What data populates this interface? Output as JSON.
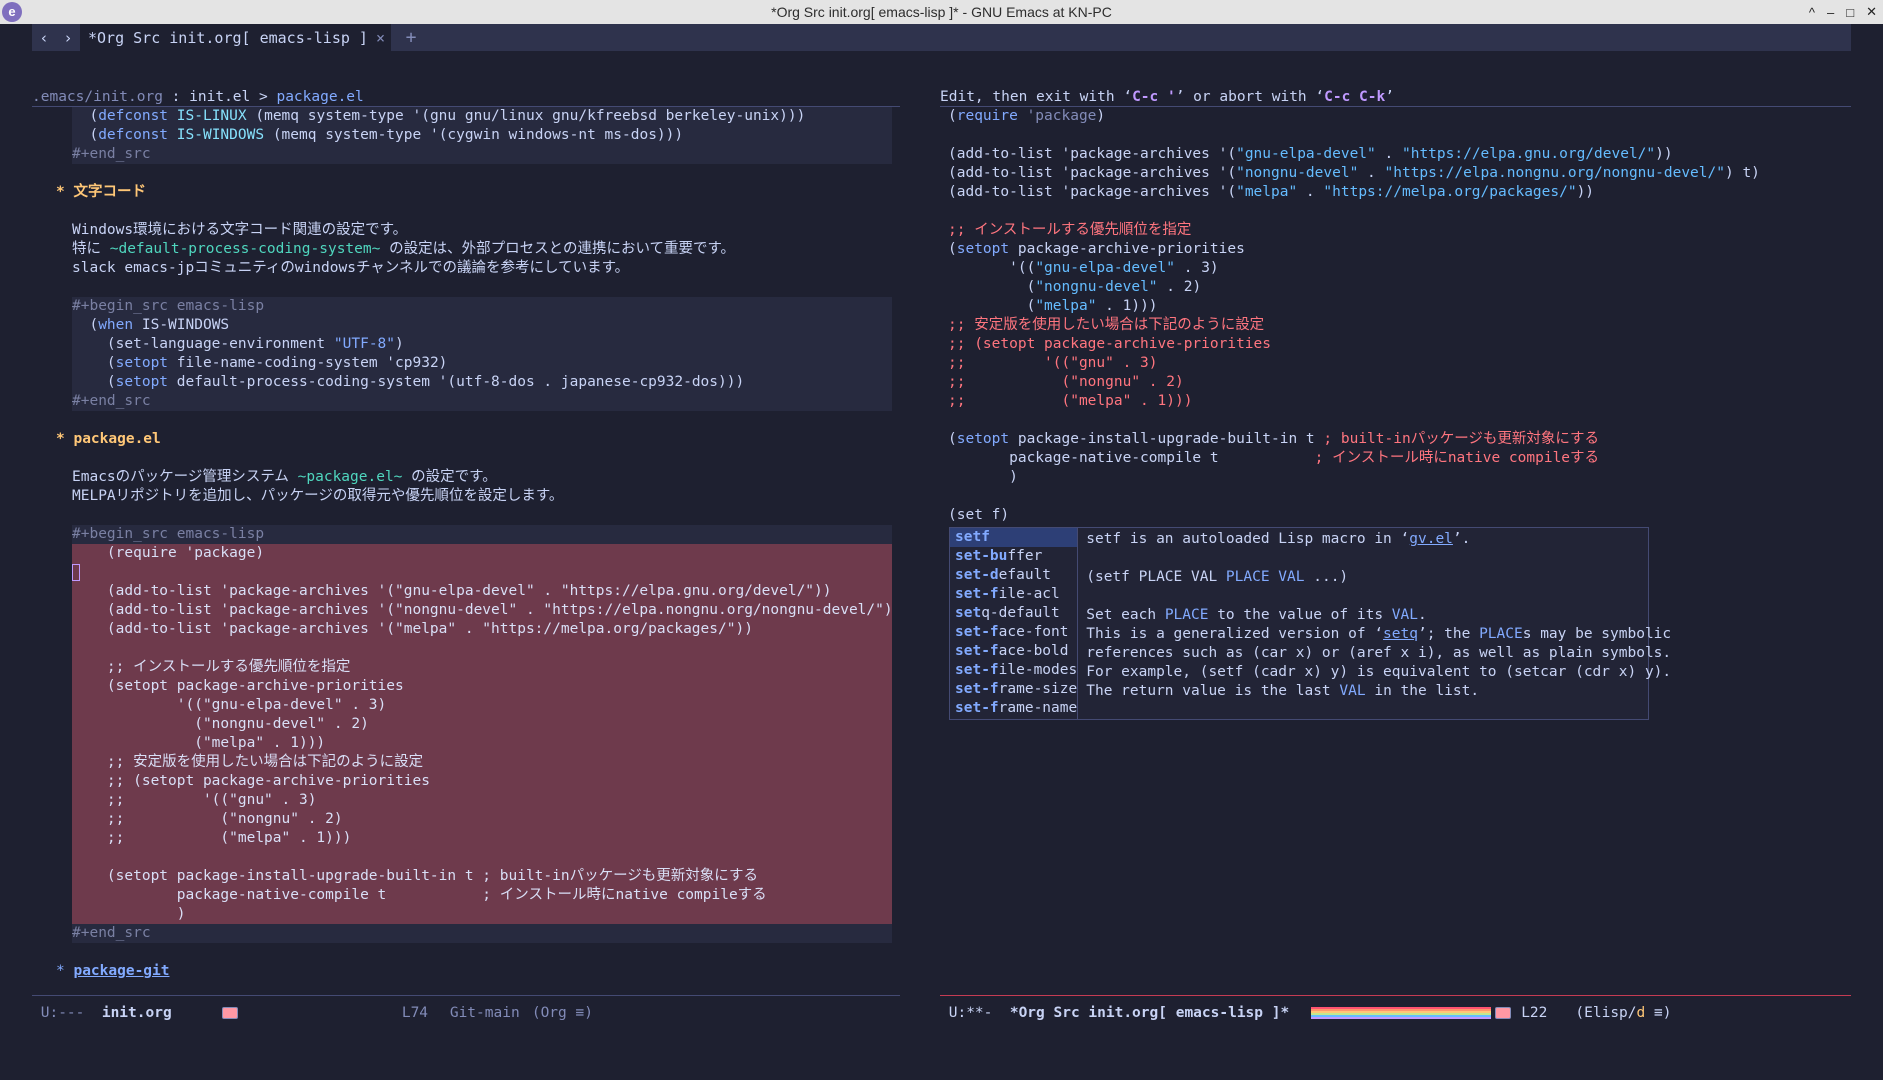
{
  "window": {
    "title": "*Org Src init.org[ emacs-lisp ]* - GNU Emacs at KN-PC",
    "app_icon": "emacs-icon",
    "controls": [
      "^",
      "–",
      "□",
      "✕"
    ]
  },
  "tabs": {
    "back": "‹",
    "forward": "›",
    "active_label": "*Org Src init.org[ emacs-lisp ]",
    "close": "×",
    "new": "+"
  },
  "left": {
    "header": {
      "path_dir": ".emacs/",
      "path_file": "init.org",
      "sep1": " : ",
      "crumb1": "init.el",
      "sep2": " > ",
      "crumb2": "package.el"
    },
    "lines_top": [
      "  (defconst IS-LINUX (memq system-type '(gnu gnu/linux gnu/kfreebsd berkeley-unix)))",
      "  (defconst IS-WINDOWS (memq system-type '(cygwin windows-nt ms-dos)))"
    ],
    "end_src": "#+end_src",
    "heading1": "* 文字コード",
    "para1": [
      "Windows環境における文字コード関連の設定です。",
      "特に ~default-process-coding-system~ の設定は、外部プロセスとの連携において重要です。",
      "slack emacs-jpコミュニティのwindowsチャンネルでの議論を参考にしています。"
    ],
    "begin_src": "#+begin_src emacs-lisp",
    "block1": [
      "  (when IS-WINDOWS",
      "    (set-language-environment \"UTF-8\")",
      "    (setopt file-name-coding-system 'cp932)",
      "    (setopt default-process-coding-system '(utf-8-dos . japanese-cp932-dos)))"
    ],
    "heading2": "* package.el",
    "para2": [
      "Emacsのパッケージ管理システム ~package.el~ の設定です。",
      "MELPAリポジトリを追加し、パッケージの取得元や優先順位を設定します。"
    ],
    "block2": [
      "    (require 'package)",
      "",
      "    (add-to-list 'package-archives '(\"gnu-elpa-devel\" . \"https://elpa.gnu.org/devel/\"))",
      "    (add-to-list 'package-archives '(\"nongnu-devel\" . \"https://elpa.nongnu.org/nongnu-devel/\") t)",
      "    (add-to-list 'package-archives '(\"melpa\" . \"https://melpa.org/packages/\"))",
      "",
      "    ;; インストールする優先順位を指定",
      "    (setopt package-archive-priorities",
      "            '((\"gnu-elpa-devel\" . 3)",
      "              (\"nongnu-devel\" . 2)",
      "              (\"melpa\" . 1)))",
      "    ;; 安定版を使用したい場合は下記のように設定",
      "    ;; (setopt package-archive-priorities",
      "    ;;         '((\"gnu\" . 3)",
      "    ;;           (\"nongnu\" . 2)",
      "    ;;           (\"melpa\" . 1)))",
      "",
      "    (setopt package-install-upgrade-built-in t ; built-inパッケージも更新対象にする",
      "            package-native-compile t           ; インストール時にnative compileする",
      "            )"
    ],
    "heading3_star": "* ",
    "heading3_link": "package-git"
  },
  "right": {
    "header": {
      "pre": "Edit, then exit with ‘",
      "k1": "C-c '",
      "mid": "’ or abort with ‘",
      "k2": "C-c C-k",
      "post": "’"
    },
    "code": {
      "require": "(require 'package)",
      "a1_pre": "(add-to-list 'package-archives '(",
      "a1_s1": "\"gnu-elpa-devel\"",
      "a1_dot": " . ",
      "a1_s2": "\"https://elpa.gnu.org/devel/\"",
      "a1_post": "))",
      "a2_s1": "\"nongnu-devel\"",
      "a2_s2": "\"https://elpa.nongnu.org/nongnu-devel/\"",
      "a2_post": ") t)",
      "a3_s1": "\"melpa\"",
      "a3_s2": "\"https://melpa.org/packages/\"",
      "c1": ";; インストールする優先順位を指定",
      "setopt1": "package-archive-priorities",
      "p1_pre": "       '((",
      "p1_s": "\"gnu-elpa-devel\"",
      "p1_post": " . 3)",
      "p2_pre": "         (",
      "p2_s": "\"nongnu-devel\"",
      "p2_post": " . 2)",
      "p3_s": "\"melpa\"",
      "p3_post": " . 1)))",
      "c2": [
        ";; 安定版を使用したい場合は下記のように設定",
        ";; (setopt package-archive-priorities",
        ";;         '((\"gnu\" . 3)",
        ";;           (\"nongnu\" . 2)",
        ";;           (\"melpa\" . 1)))"
      ],
      "s2_a": " package-install-upgrade-built-in t ",
      "s2_c1": "; built-inパッケージも更新対象にする",
      "s2_b": "       package-native-compile t           ",
      "s2_c2": "; インストール時にnative compileする",
      "s2_close": "       )",
      "typing": "(set f)"
    },
    "completion": {
      "candidates": [
        {
          "m": "setf",
          "r": ""
        },
        {
          "m": "set-bu",
          "r": "ffer"
        },
        {
          "m": "set-d",
          "r": "efault"
        },
        {
          "m": "set-f",
          "r": "ile-acl"
        },
        {
          "m": "set",
          "r": "q-default"
        },
        {
          "m": "set-f",
          "r": "ace-font"
        },
        {
          "m": "set-f",
          "r": "ace-bold"
        },
        {
          "m": "set-f",
          "r": "ile-modes"
        },
        {
          "m": "set-f",
          "r": "rame-size"
        },
        {
          "m": "set-f",
          "r": "rame-name"
        }
      ],
      "doc": {
        "l1_pre": "setf is an autoloaded Lisp macro in ‘",
        "l1_link": "gv.el",
        "l1_post": "’.",
        "l3_pre": "(setf PLACE VAL ",
        "l3_args": "PLACE VAL",
        "l3_post": " ...)",
        "l5_pre": "Set each ",
        "l5_k1": "PLACE",
        "l5_mid": " to the value of its ",
        "l5_k2": "VAL",
        "l5_post": ".",
        "l6_pre": "This is a generalized version of ‘",
        "l6_link": "setq",
        "l6_mid": "’; the ",
        "l6_k": "PLACE",
        "l6_post": "s may be symbolic",
        "l7": "references such as (car x) or (aref x i), as well as plain symbols.",
        "l8": "For example, (setf (cadr x) y) is equivalent to (setcar (cdr x) y).",
        "l9_pre": "The return value is the last ",
        "l9_k": "VAL",
        "l9_post": " in the list."
      }
    }
  },
  "modeline_left": {
    "state": " U:---  ",
    "buffer": "init.org",
    "line": "L74",
    "vc": "Git-main",
    "mode": "(Org ≡)"
  },
  "modeline_right": {
    "state": " U:**-  ",
    "buffer": "*Org Src init.org[ emacs-lisp ]*",
    "line": "L22",
    "mode_pre": "(Elisp/",
    "mode_d": "d",
    "mode_post": " ≡)"
  }
}
